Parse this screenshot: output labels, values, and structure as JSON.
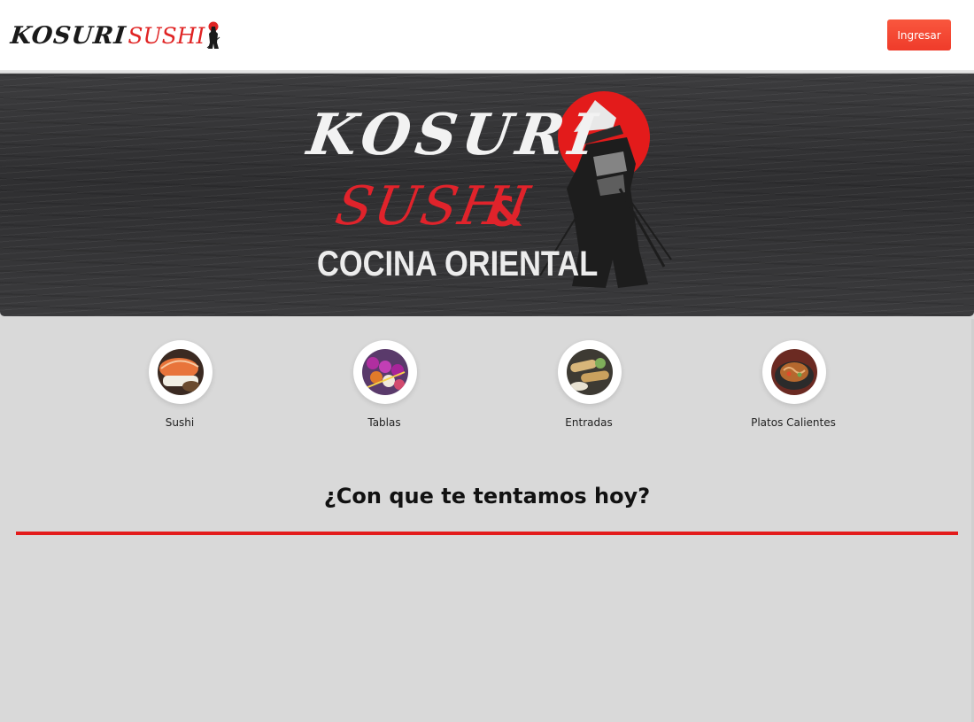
{
  "header": {
    "logo": {
      "word1": "KOSURI",
      "word2": "SUSHI",
      "icon": "samurai-icon"
    },
    "login_label": "Ingresar"
  },
  "hero": {
    "brand_word1": "KOSURI",
    "brand_word2": "SUSHI",
    "ampersand": "&",
    "tagline": "COCINA ORIENTAL",
    "art": "samurai-with-red-sun"
  },
  "categories": [
    {
      "label": "Sushi",
      "icon": "sushi-image"
    },
    {
      "label": "Tablas",
      "icon": "sushi-platter-image"
    },
    {
      "label": "Entradas",
      "icon": "spring-rolls-image"
    },
    {
      "label": "Platos Calientes",
      "icon": "hot-dish-image"
    }
  ],
  "section": {
    "title": "¿Con que te tentamos hoy?"
  },
  "colors": {
    "accent": "#e31b1b",
    "button": "#f4492f",
    "background": "#d9d9d9",
    "hero": "#343436"
  }
}
